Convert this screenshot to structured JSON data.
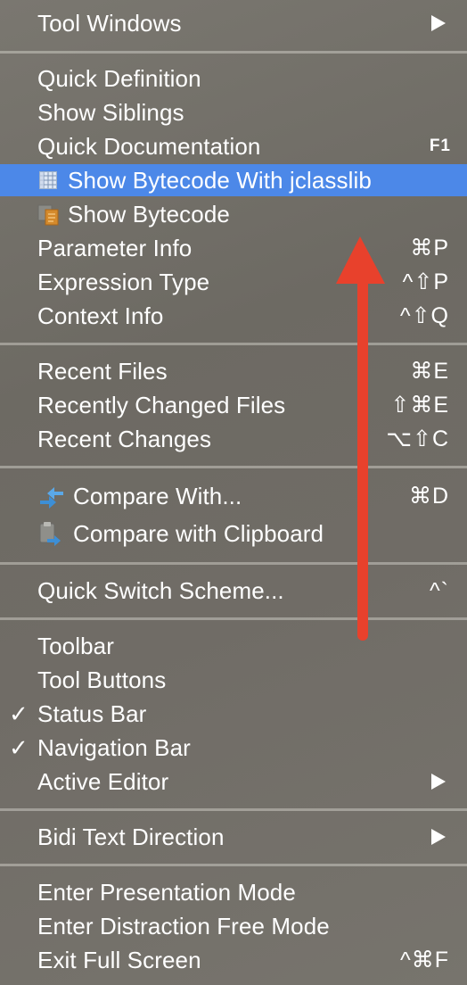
{
  "menu": {
    "groups": [
      {
        "items": [
          {
            "label": "Tool Windows",
            "shortcut": "",
            "submenu": true
          }
        ]
      },
      {
        "items": [
          {
            "label": "Quick Definition",
            "shortcut": ""
          },
          {
            "label": "Show Siblings",
            "shortcut": ""
          },
          {
            "label": "Quick Documentation",
            "shortcut": "F1"
          },
          {
            "label": "Show Bytecode With jclasslib",
            "shortcut": "",
            "highlighted": true,
            "icon": "jclasslib-grid-icon"
          },
          {
            "label": "Show Bytecode",
            "shortcut": "",
            "icon": "bytecode-document-icon"
          },
          {
            "label": "Parameter Info",
            "shortcut": "⌘P"
          },
          {
            "label": "Expression Type",
            "shortcut": "^⇧P"
          },
          {
            "label": "Context Info",
            "shortcut": "^⇧Q"
          }
        ]
      },
      {
        "items": [
          {
            "label": "Recent Files",
            "shortcut": "⌘E"
          },
          {
            "label": "Recently Changed Files",
            "shortcut": "⇧⌘E"
          },
          {
            "label": "Recent Changes",
            "shortcut": "⌥⇧C"
          }
        ]
      },
      {
        "items": [
          {
            "label": "Compare With...",
            "shortcut": "⌘D",
            "icon": "compare-arrows-icon"
          },
          {
            "label": "Compare with Clipboard",
            "shortcut": "",
            "icon": "compare-clipboard-icon"
          }
        ]
      },
      {
        "items": [
          {
            "label": "Quick Switch Scheme...",
            "shortcut": "^`"
          }
        ]
      },
      {
        "items": [
          {
            "label": "Toolbar",
            "shortcut": ""
          },
          {
            "label": "Tool Buttons",
            "shortcut": ""
          },
          {
            "label": "Status Bar",
            "shortcut": "",
            "checked": true
          },
          {
            "label": "Navigation Bar",
            "shortcut": "",
            "checked": true
          },
          {
            "label": "Active Editor",
            "shortcut": "",
            "submenu": true
          }
        ]
      },
      {
        "items": [
          {
            "label": "Bidi Text Direction",
            "shortcut": "",
            "submenu": true
          }
        ]
      },
      {
        "items": [
          {
            "label": "Enter Presentation Mode",
            "shortcut": ""
          },
          {
            "label": "Enter Distraction Free Mode",
            "shortcut": ""
          },
          {
            "label": "Exit Full Screen",
            "shortcut": "^⌘F"
          }
        ]
      }
    ],
    "check_glyph": "✓",
    "colors": {
      "highlight": "#4c88e8",
      "annotation_arrow": "#e8412c"
    }
  }
}
